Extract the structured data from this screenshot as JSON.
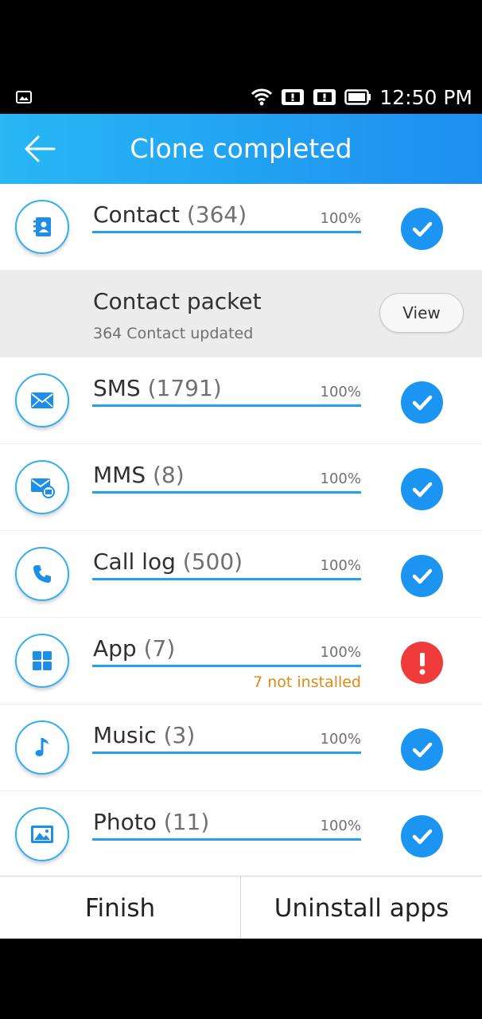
{
  "status_bar": {
    "time": "12:50 PM",
    "icons": [
      "image-notification-icon",
      "wifi-icon",
      "alert-icon",
      "alert-icon",
      "battery-icon"
    ]
  },
  "app_bar": {
    "title": "Clone completed",
    "back_icon": "back-arrow-icon"
  },
  "items": [
    {
      "id": "contact",
      "name": "Contact",
      "count": "(364)",
      "percent": "100%",
      "progress": 1.0,
      "status": "success",
      "icon": "contact-book-icon"
    },
    {
      "id": "sms",
      "name": "SMS",
      "count": "(1791)",
      "percent": "100%",
      "progress": 1.0,
      "status": "success",
      "icon": "envelope-icon"
    },
    {
      "id": "mms",
      "name": "MMS",
      "count": "(8)",
      "percent": "100%",
      "progress": 1.0,
      "status": "success",
      "icon": "mms-envelope-icon"
    },
    {
      "id": "call-log",
      "name": "Call log",
      "count": "(500)",
      "percent": "100%",
      "progress": 1.0,
      "status": "success",
      "icon": "phone-icon"
    },
    {
      "id": "app",
      "name": "App",
      "count": "(7)",
      "percent": "100%",
      "progress": 1.0,
      "status": "error",
      "note": "7 not installed",
      "icon": "app-grid-icon"
    },
    {
      "id": "music",
      "name": "Music",
      "count": "(3)",
      "percent": "100%",
      "progress": 1.0,
      "status": "success",
      "icon": "music-note-icon"
    },
    {
      "id": "photo",
      "name": "Photo",
      "count": "(11)",
      "percent": "100%",
      "progress": 1.0,
      "status": "success",
      "icon": "picture-icon"
    }
  ],
  "contact_packet": {
    "title": "Contact packet",
    "subtitle": "364 Contact updated",
    "view_label": "View"
  },
  "bottom_bar": {
    "finish_label": "Finish",
    "uninstall_label": "Uninstall apps"
  },
  "colors": {
    "accent": "#1d8ff0",
    "success": "#1c94f1",
    "error": "#ef3b3b",
    "warning_text": "#e08a16"
  }
}
